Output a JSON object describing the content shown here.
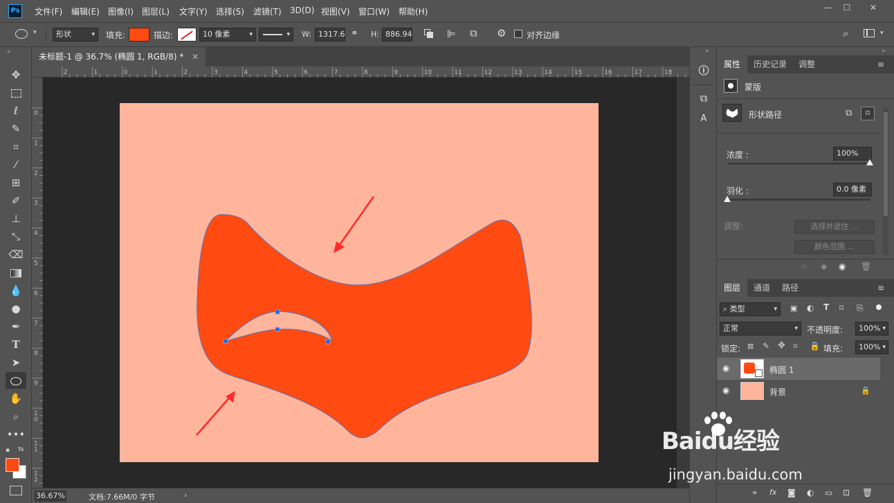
{
  "app": {
    "logo": "Ps"
  },
  "menu": [
    "文件(F)",
    "编辑(E)",
    "图像(I)",
    "图层(L)",
    "文字(Y)",
    "选择(S)",
    "滤镜(T)",
    "3D(D)",
    "视图(V)",
    "窗口(W)",
    "帮助(H)"
  ],
  "window_buttons": [
    "—",
    "☐",
    "✕"
  ],
  "options": {
    "mode": "形状",
    "fill_label": "填充:",
    "fill_color": "#ff4b12",
    "stroke_label": "描边:",
    "stroke_width": "10 像素",
    "w_label": "W:",
    "w_value": "1317.66",
    "h_label": "H:",
    "h_value": "886.94",
    "align_edges": "对齐边缘"
  },
  "document": {
    "tab_title": "未标题-1 @ 36.7% (椭圆 1, RGB/8) *",
    "ruler_top": [
      "2",
      "1",
      "0",
      "1",
      "2",
      "3",
      "4",
      "5",
      "6",
      "7",
      "8",
      "9",
      "10",
      "11",
      "12",
      "13",
      "14",
      "15",
      "16",
      "17",
      "18"
    ],
    "ruler_left": [
      "0",
      "1",
      "2",
      "3",
      "4",
      "5",
      "6",
      "7",
      "8",
      "9",
      "1\n0",
      "1\n1",
      "1\n2"
    ],
    "canvas_color": "#ffb59b",
    "shape_color": "#ff4b12",
    "arrow_color": "#ff2a2a"
  },
  "status": {
    "zoom": "36.67%",
    "doc_info": "文档:7.66M/0 字节"
  },
  "properties": {
    "tabs": [
      "属性",
      "历史记录",
      "调整"
    ],
    "mask_label": "蒙版",
    "shape_path_label": "形状路径",
    "density_label": "浓度 :",
    "density_value": "100%",
    "feather_label": "羽化 :",
    "feather_value": "0.0 像素",
    "adjust_label": "调整:",
    "select_mask_btn": "选择并遮住 ...",
    "color_range_btn": "颜色范围 ..."
  },
  "layers": {
    "tabs": [
      "图层",
      "通道",
      "路径"
    ],
    "filter_type": "类型",
    "blend_mode": "正常",
    "opacity_label": "不透明度:",
    "opacity_value": "100%",
    "lock_label": "锁定:",
    "fill_label": "填充:",
    "fill_value": "100%",
    "items": [
      {
        "name": "椭圆 1"
      },
      {
        "name": "背景"
      }
    ]
  },
  "watermark": {
    "brand": "Baidu经验",
    "url": "jingyan.baidu.com"
  }
}
